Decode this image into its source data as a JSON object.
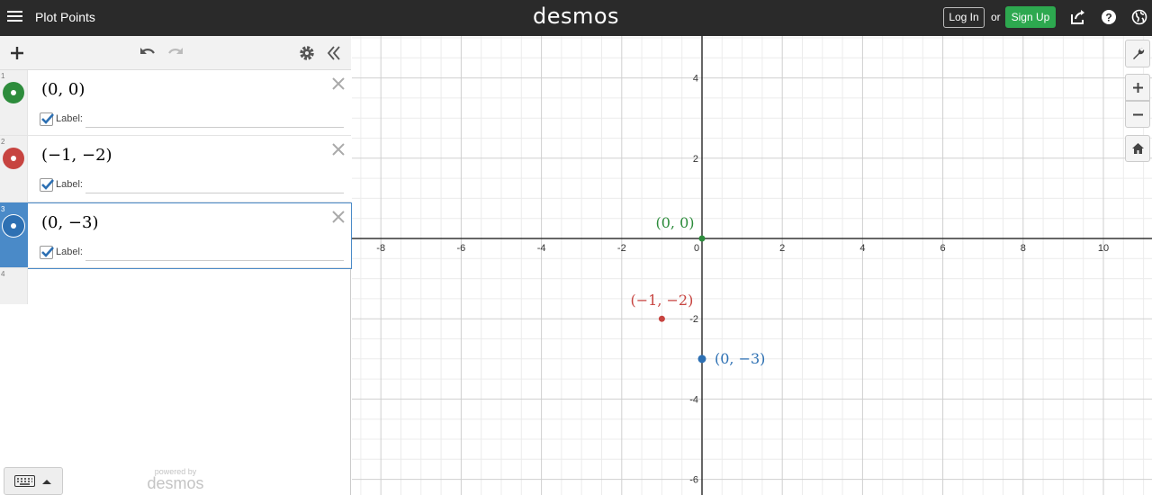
{
  "header": {
    "title": "Plot Points",
    "logo": "desmos",
    "login_label": "Log In",
    "or_text": "or",
    "signup_label": "Sign Up",
    "signup_color": "#2da84f"
  },
  "toolbar": {
    "icons": [
      "plus-icon",
      "undo-icon",
      "redo-icon",
      "gear-icon",
      "collapse-icon"
    ]
  },
  "expressions": [
    {
      "index": "1",
      "math": "(0, 0)",
      "color": "#2d8c3c",
      "label_checked": true,
      "label_text": "Label:",
      "label_value": ""
    },
    {
      "index": "2",
      "math": "(−1, −2)",
      "color": "#c74440",
      "label_checked": true,
      "label_text": "Label:",
      "label_value": ""
    },
    {
      "index": "3",
      "math": "(0, −3)",
      "color": "#2d70b3",
      "label_checked": true,
      "label_text": "Label:",
      "label_value": ""
    },
    {
      "index": "4"
    }
  ],
  "footer": {
    "powered_by": "powered by",
    "brand": "desmos"
  },
  "graph": {
    "x_ticks": [
      "-8",
      "-6",
      "-4",
      "-2",
      "0",
      "2",
      "4",
      "6",
      "8",
      "10"
    ],
    "y_ticks": [
      "4",
      "2",
      "-2",
      "-4",
      "-6"
    ],
    "points": [
      {
        "x": 0,
        "y": 0,
        "label": "(0, 0)",
        "color": "#2d8c3c"
      },
      {
        "x": -1,
        "y": -2,
        "label": "(−1, −2)",
        "color": "#c74440"
      },
      {
        "x": 0,
        "y": -3,
        "label": "(0, −3)",
        "color": "#2d70b3"
      }
    ]
  }
}
